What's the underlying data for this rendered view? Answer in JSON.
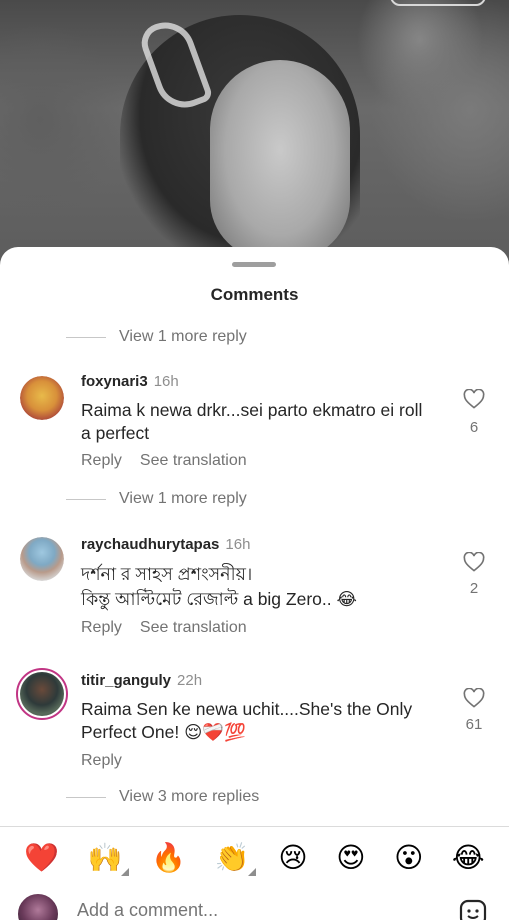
{
  "sheet": {
    "title": "Comments"
  },
  "view_more_top": "View 1 more reply",
  "comments": [
    {
      "username": "foxynari3",
      "time": "16h",
      "text": "Raima k newa drkr...sei parto ekmatro ei roll a perfect",
      "reply_label": "Reply",
      "translate_label": "See translation",
      "likes": "6"
    },
    {
      "username": "raychaudhurytapas",
      "time": "16h",
      "text_line1": "দর্শনা র সাহস প্রশংসনীয়।",
      "text_line2": "কিন্তু আল্টিমেট রেজাল্ট a big Zero.. 😂",
      "reply_label": "Reply",
      "translate_label": "See translation",
      "likes": "2"
    },
    {
      "username": "titir_ganguly",
      "time": "22h",
      "text": "Raima Sen ke newa uchit....She's the Only Perfect One! 😌❤️‍🩹💯",
      "reply_label": "Reply",
      "likes": "61"
    }
  ],
  "view_more_mid": "View 1 more reply",
  "view_more_bottom": "View 3 more replies",
  "reactions": [
    "❤️",
    "🙌",
    "🔥",
    "👏",
    "😢",
    "😍",
    "😮",
    "😂"
  ],
  "add_comment": {
    "placeholder": "Add a comment..."
  },
  "colors": {
    "heart_outline": "#737373",
    "story_ring": "#c13584"
  }
}
